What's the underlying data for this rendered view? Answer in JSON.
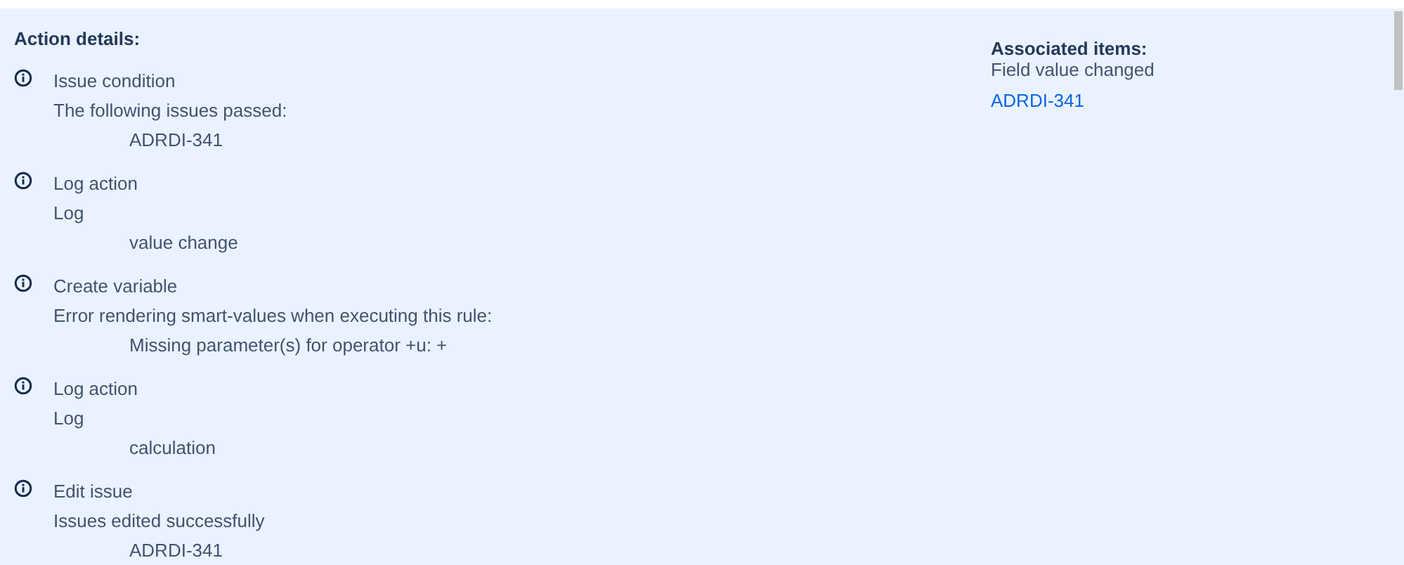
{
  "action_details": {
    "heading": "Action details:",
    "entries": [
      {
        "title": "Issue condition",
        "detail": "The following issues passed:",
        "value": "ADRDI-341"
      },
      {
        "title": "Log action",
        "detail": "Log",
        "value": "value change"
      },
      {
        "title": "Create variable",
        "detail": "Error rendering smart-values when executing this rule:",
        "value": "Missing parameter(s) for operator +u: +"
      },
      {
        "title": "Log action",
        "detail": "Log",
        "value": "calculation"
      },
      {
        "title": "Edit issue",
        "detail": "Issues edited successfully",
        "value": "ADRDI-341"
      }
    ]
  },
  "associated_items": {
    "heading": "Associated items:",
    "trigger": "Field value changed",
    "link": "ADRDI-341"
  }
}
